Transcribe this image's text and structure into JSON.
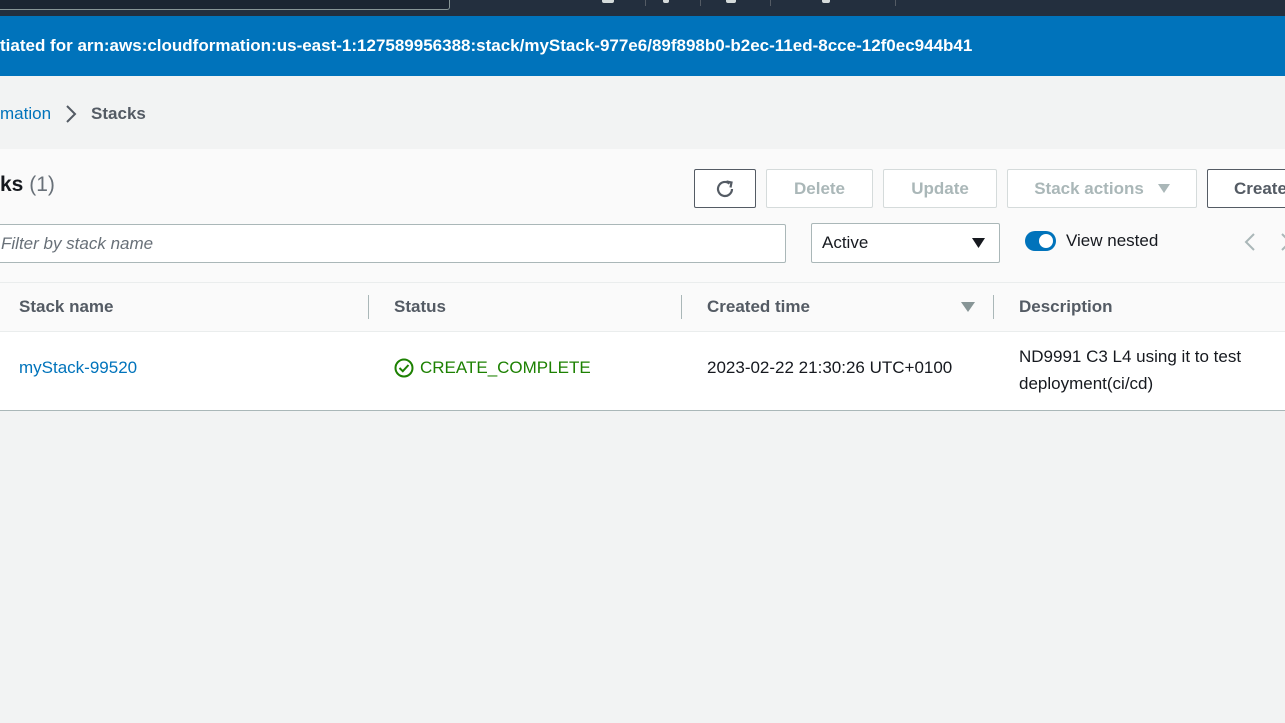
{
  "flash": {
    "message": "tiated for arn:aws:cloudformation:us-east-1:127589956388:stack/myStack-977e6/89f898b0-b2ec-11ed-8cce-12f0ec944b41"
  },
  "breadcrumb": {
    "parent": "mation",
    "current": "Stacks"
  },
  "header": {
    "title": "ks",
    "count": "(1)"
  },
  "toolbar": {
    "delete_label": "Delete",
    "update_label": "Update",
    "stack_actions_label": "Stack actions",
    "create_label": "Create"
  },
  "filter": {
    "placeholder": "Filter by stack name",
    "status_value": "Active",
    "view_nested_label": "View nested"
  },
  "table": {
    "columns": [
      "Stack name",
      "Status",
      "Created time",
      "Description"
    ],
    "rows": [
      {
        "name": "myStack-99520",
        "status": "CREATE_COMPLETE",
        "created": "2023-02-22 21:30:26 UTC+0100",
        "description": "ND9991 C3 L4 using it to test deployment(ci/cd)"
      }
    ]
  },
  "colors": {
    "primary": "#0073bb",
    "success": "#1d8102",
    "nav_bg": "#232f3e"
  },
  "icons": [
    "refresh-icon",
    "caret-down-icon",
    "chevron-right-icon",
    "chevron-left-icon",
    "check-circle-icon",
    "sort-down-icon"
  ]
}
